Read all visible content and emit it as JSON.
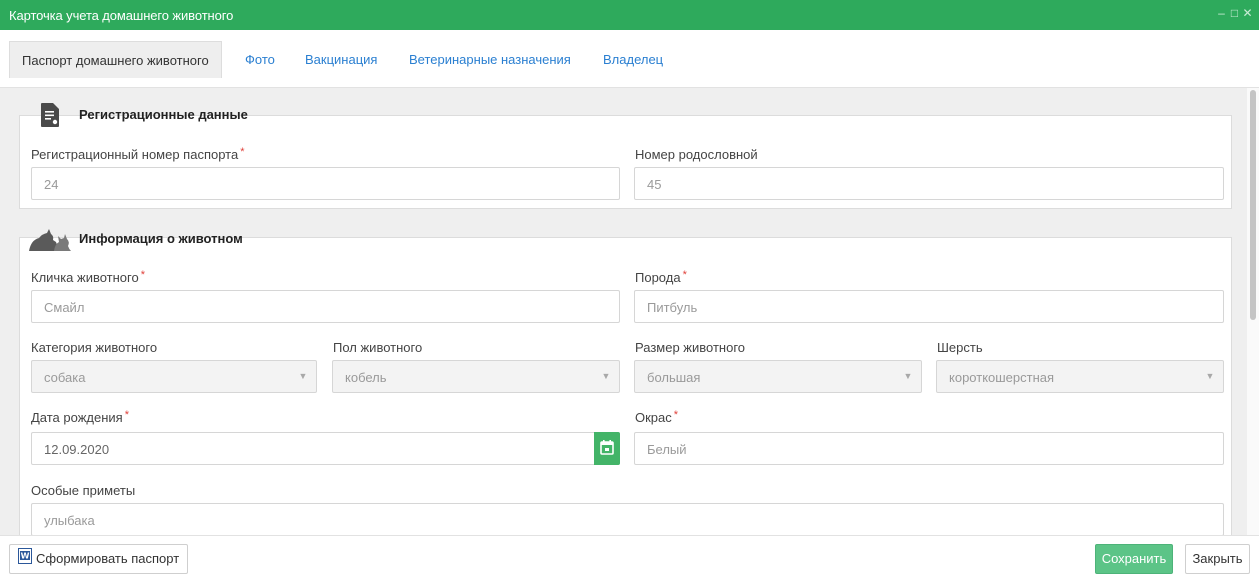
{
  "window": {
    "title": "Карточка учета домашнего животного",
    "controls": [
      "–",
      "□",
      "✕"
    ]
  },
  "tabs": [
    {
      "label": "Паспорт домашнего животного",
      "active": true
    },
    {
      "label": "Фото",
      "active": false
    },
    {
      "label": "Вакцинация",
      "active": false
    },
    {
      "label": "Ветеринарные назначения",
      "active": false
    },
    {
      "label": "Владелец",
      "active": false
    }
  ],
  "registration": {
    "heading": "Регистрационные данные",
    "icon": "document-icon",
    "passport_number": {
      "label": "Регистрационный номер паспорта",
      "required": "*",
      "value": "24"
    },
    "pedigree_number": {
      "label": "Номер родословной",
      "value": "45"
    }
  },
  "animal": {
    "heading": "Информация о животном",
    "icon": "pets-icon",
    "name": {
      "label": "Кличка животного",
      "required": "*",
      "value": "Смайл"
    },
    "breed": {
      "label": "Порода",
      "required": "*",
      "value": "Питбуль"
    },
    "category": {
      "label": "Категория животного",
      "value": "собака"
    },
    "sex": {
      "label": "Пол животного",
      "value": "кобель"
    },
    "size": {
      "label": "Размер животного",
      "value": "большая"
    },
    "coat": {
      "label": "Шерсть",
      "value": "короткошерстная"
    },
    "birth_date": {
      "label": "Дата рождения",
      "required": "*",
      "value": "12.09.2020"
    },
    "color": {
      "label": "Окрас",
      "required": "*",
      "value": "Белый"
    },
    "special_marks": {
      "label": "Особые приметы",
      "value": "улыбака"
    }
  },
  "footer": {
    "generate_passport": "Сформировать паспорт",
    "save": "Сохранить",
    "close": "Закрыть"
  },
  "colors": {
    "accent": "#2eaa5c",
    "save_button": "#5cc487",
    "link": "#2a7fd1",
    "required": "#e0413a"
  }
}
